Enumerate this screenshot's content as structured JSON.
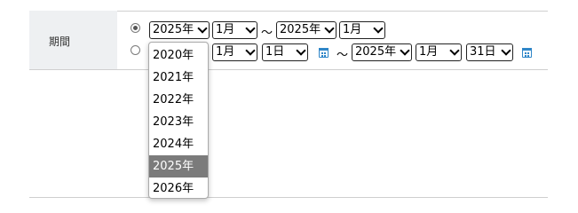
{
  "period_label": "期間",
  "row1": {
    "start_year": "2025年",
    "start_month": "1月",
    "tilde": "～",
    "end_year": "2025年",
    "end_month": "1月"
  },
  "row2": {
    "start_month": "1月",
    "start_day": "1日",
    "tilde": "～",
    "end_year": "2025年",
    "end_month": "1月",
    "end_day": "31日"
  },
  "year_dropdown": {
    "options": [
      "2020年",
      "2021年",
      "2022年",
      "2023年",
      "2024年",
      "2025年",
      "2026年"
    ],
    "selected": "2025年"
  },
  "icons": {
    "calendar": "calendar-icon",
    "chevron": "chevron-down-icon"
  },
  "colors": {
    "label_bg": "#eef0f2",
    "calendar": "#2f86c8",
    "selected_option": "#7b7b7b"
  }
}
